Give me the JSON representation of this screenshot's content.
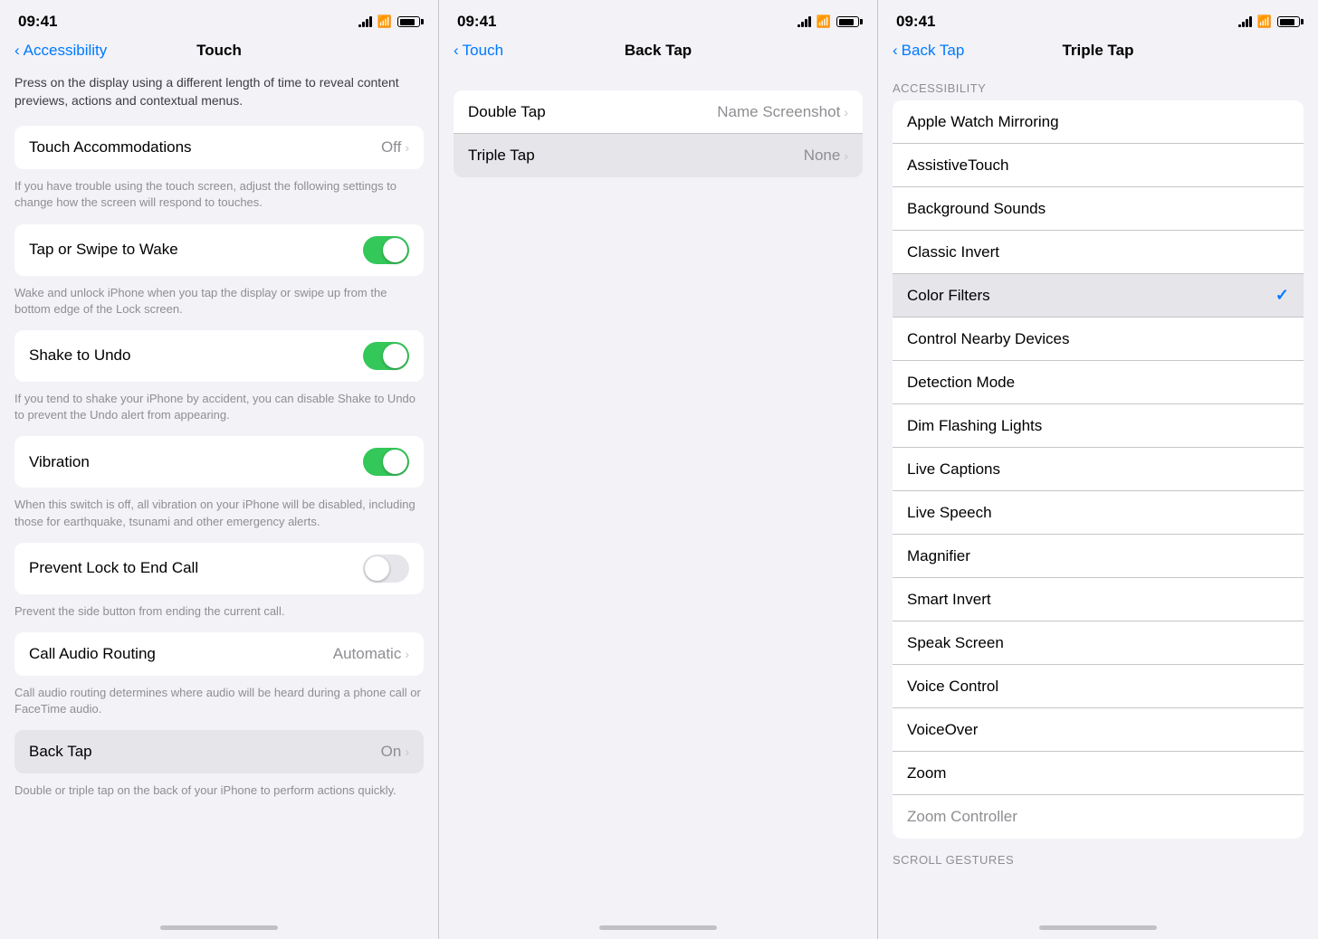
{
  "panels": [
    {
      "id": "panel1",
      "statusBar": {
        "time": "09:41",
        "signalBars": [
          3,
          6,
          9,
          12
        ],
        "batteryPercent": 80
      },
      "navBar": {
        "backLabel": "Accessibility",
        "title": "Touch"
      },
      "introText": "Press on the display using a different length of time to reveal content previews, actions and contextual menus.",
      "sections": [
        {
          "type": "setting-with-value",
          "label": "Touch Accommodations",
          "value": "Off",
          "hasChevron": true
        },
        {
          "type": "description",
          "text": "If you have trouble using the touch screen, adjust the following settings to change how the screen will respond to touches."
        },
        {
          "type": "setting-with-toggle",
          "label": "Tap or Swipe to Wake",
          "enabled": true,
          "description": "Wake and unlock iPhone when you tap the display or swipe up from the bottom edge of the Lock screen."
        },
        {
          "type": "setting-with-toggle",
          "label": "Shake to Undo",
          "enabled": true,
          "description": "If you tend to shake your iPhone by accident, you can disable Shake to Undo to prevent the Undo alert from appearing."
        },
        {
          "type": "setting-with-toggle",
          "label": "Vibration",
          "enabled": true,
          "description": "When this switch is off, all vibration on your iPhone will be disabled, including those for earthquake, tsunami and other emergency alerts."
        },
        {
          "type": "setting-with-toggle",
          "label": "Prevent Lock to End Call",
          "enabled": false,
          "description": "Prevent the side button from ending the current call."
        },
        {
          "type": "setting-with-value",
          "label": "Call Audio Routing",
          "value": "Automatic",
          "hasChevron": true,
          "description": "Call audio routing determines where audio will be heard during a phone call or FaceTime audio."
        },
        {
          "type": "setting-with-value",
          "label": "Back Tap",
          "value": "On",
          "hasChevron": true,
          "highlighted": true,
          "description": "Double or triple tap on the back of your iPhone to perform actions quickly."
        }
      ]
    },
    {
      "id": "panel2",
      "statusBar": {
        "time": "09:41"
      },
      "navBar": {
        "backLabel": "Touch",
        "title": "Back Tap"
      },
      "items": [
        {
          "label": "Double Tap",
          "value": "Name Screenshot",
          "hasChevron": true
        },
        {
          "label": "Triple Tap",
          "value": "None",
          "hasChevron": true,
          "highlighted": true
        }
      ]
    },
    {
      "id": "panel3",
      "statusBar": {
        "time": "09:41"
      },
      "navBar": {
        "backLabel": "Back Tap",
        "title": "Triple Tap"
      },
      "sectionHeader": "ACCESSIBILITY",
      "accessibilityItems": [
        {
          "label": "Apple Watch Mirroring",
          "selected": false
        },
        {
          "label": "AssistiveTouch",
          "selected": false
        },
        {
          "label": "Background Sounds",
          "selected": false
        },
        {
          "label": "Classic Invert",
          "selected": false
        },
        {
          "label": "Color Filters",
          "selected": true
        },
        {
          "label": "Control Nearby Devices",
          "selected": false
        },
        {
          "label": "Detection Mode",
          "selected": false
        },
        {
          "label": "Dim Flashing Lights",
          "selected": false
        },
        {
          "label": "Live Captions",
          "selected": false
        },
        {
          "label": "Live Speech",
          "selected": false
        },
        {
          "label": "Magnifier",
          "selected": false
        },
        {
          "label": "Smart Invert",
          "selected": false
        },
        {
          "label": "Speak Screen",
          "selected": false
        },
        {
          "label": "Voice Control",
          "selected": false
        },
        {
          "label": "VoiceOver",
          "selected": false
        },
        {
          "label": "Zoom",
          "selected": false
        },
        {
          "label": "Zoom Controller",
          "selected": false
        }
      ],
      "scrollSectionHeader": "SCROLL GESTURES"
    }
  ]
}
